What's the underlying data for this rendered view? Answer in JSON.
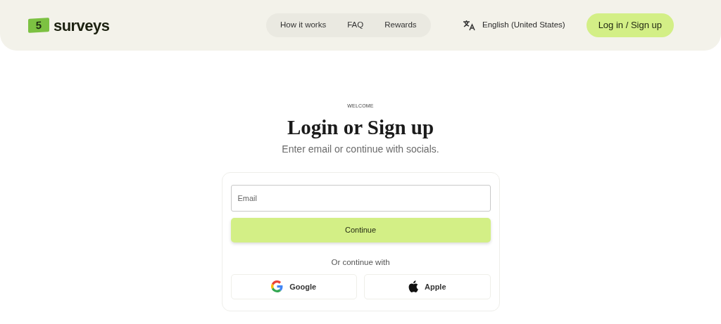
{
  "header": {
    "logo": {
      "mark": "5",
      "name": "surveys"
    },
    "nav": [
      "How it works",
      "FAQ",
      "Rewards"
    ],
    "language": "English (United States)",
    "login_button": "Log in / Sign up"
  },
  "main": {
    "eyebrow": "WELCOME",
    "title": "Login or Sign up",
    "subtitle": "Enter email or continue with socials.",
    "email": {
      "placeholder": "Email"
    },
    "continue_button": "Continue",
    "divider": "Or continue with",
    "socials": [
      {
        "kind": "google",
        "label": "Google"
      },
      {
        "kind": "apple",
        "label": "Apple"
      }
    ]
  }
}
